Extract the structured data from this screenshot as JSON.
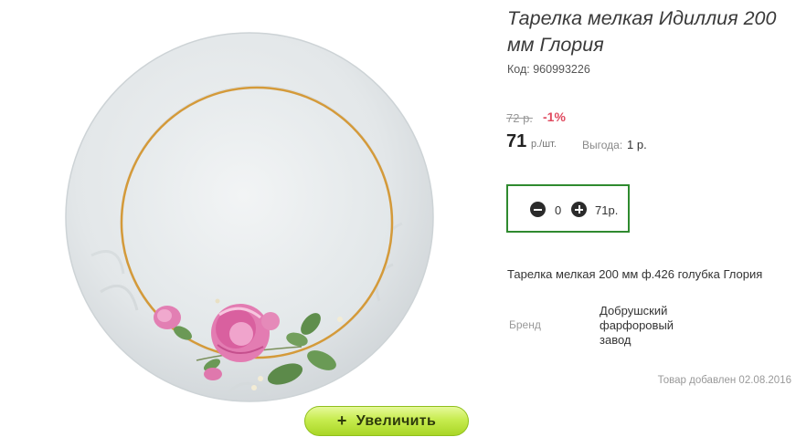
{
  "product": {
    "title": "Тарелка мелкая Идиллия 200 мм Глория",
    "code_label": "Код:",
    "code": "960993226",
    "old_price": "72 р.",
    "discount": "-1%",
    "price": "71",
    "unit": "р./шт.",
    "saving_label": "Выгода:",
    "saving_value": "1 р.",
    "description": "Тарелка мелкая 200 мм ф.426 голубка Глория",
    "brand_label": "Бренд",
    "brand_value": "Добрушский фарфоровый завод",
    "added_text": "Товар добавлен 02.08.2016"
  },
  "cart": {
    "quantity": "0",
    "total": "71р.",
    "minus_icon": "minus-circle-icon",
    "plus_icon": "plus-circle-icon"
  },
  "gallery": {
    "zoom_plus": "+",
    "zoom_label": "Увеличить",
    "image_subject": "plate-with-rose-pattern"
  },
  "colors": {
    "accent_green_border": "#2f8a2f",
    "discount_red": "#e04a5f",
    "zoom_button": "#c7ec4f",
    "plate_gold_rim": "#d49a3a"
  }
}
